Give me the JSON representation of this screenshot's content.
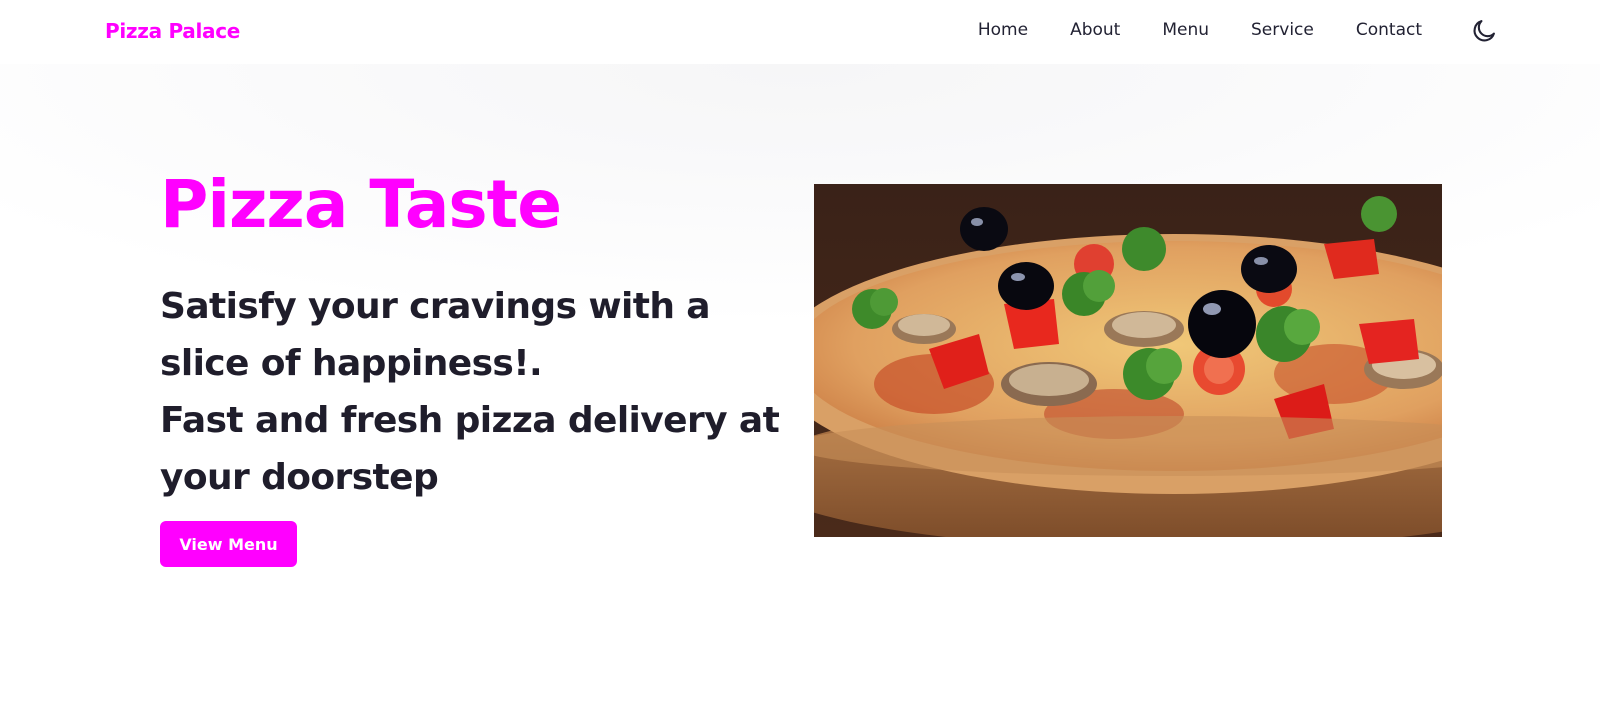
{
  "brand": {
    "name": "Pizza Palace",
    "color": "#ff00ff"
  },
  "nav": {
    "items": [
      {
        "label": "Home"
      },
      {
        "label": "About"
      },
      {
        "label": "Menu"
      },
      {
        "label": "Service"
      },
      {
        "label": "Contact"
      }
    ],
    "theme_toggle_icon": "moon-icon"
  },
  "hero": {
    "title": "Pizza Taste",
    "subtitle_line1": "Satisfy your cravings with a",
    "subtitle_line2": "slice of happiness!.",
    "subtitle_line3": "Fast and fresh pizza delivery at",
    "subtitle_line4": "your doorstep",
    "cta_label": "View Menu",
    "image_alt": "pizza-photo"
  },
  "colors": {
    "accent": "#ff00ff",
    "text_dark": "#1f1d2b",
    "nav_text": "#222233"
  }
}
